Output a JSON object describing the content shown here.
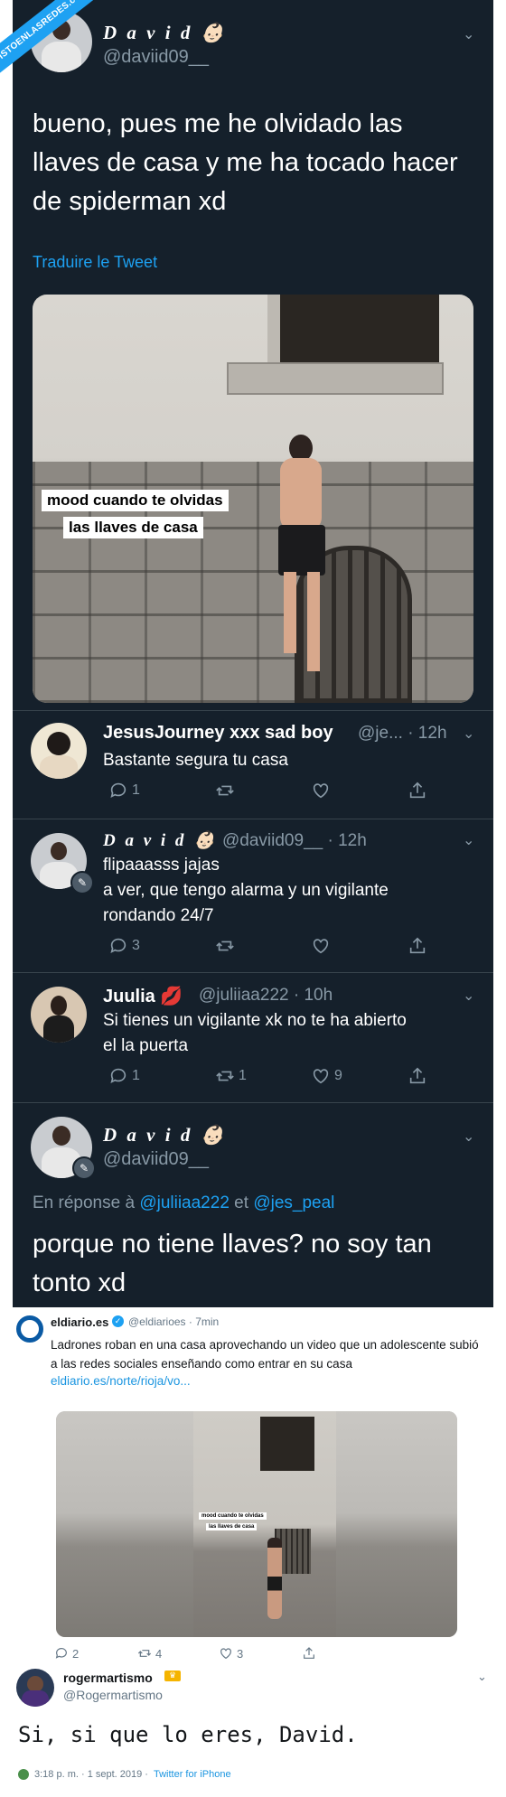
{
  "watermark": "VISTOENLASREDES.com",
  "main_tweet": {
    "name": "D a v i d",
    "name_emoji": "👶🏻",
    "handle": "@daviid09__",
    "text": "bueno, pues me he olvidado las llaves de casa y me ha tocado hacer de spiderman xd",
    "translate_label": "Traduire le Tweet",
    "media_caption_line1": "mood cuando te olvidas",
    "media_caption_line2": "las llaves de casa"
  },
  "replies": [
    {
      "name": "JesusJourney xxx sad boy",
      "handle": "@je...",
      "time": "· 12h",
      "text": "Bastante segura tu casa",
      "reply_count": "1",
      "retweet_count": "",
      "like_count": ""
    },
    {
      "name": "D a v i d",
      "name_emoji": "👶🏻",
      "handle": "@daviid09__",
      "time": "· 12h",
      "text_line1": "flipaaasss jajas",
      "text_line2": "a ver, que tengo alarma y un vigilante",
      "text_line3": "rondando 24/7",
      "reply_count": "3",
      "retweet_count": "",
      "like_count": ""
    },
    {
      "name": "Juulia",
      "name_emoji": "💋",
      "handle": "@juliiaa222",
      "time": "· 10h",
      "text_line1": "Si tienes un vigilante xk no te ha abierto",
      "text_line2": "el la puerta",
      "reply_count": "1",
      "retweet_count": "1",
      "like_count": "9"
    }
  ],
  "final_tweet": {
    "name": "D a v i d",
    "name_emoji": "👶🏻",
    "handle": "@daviid09__",
    "in_reply_prefix": "En réponse à",
    "in_reply_user1": "@juliiaa222",
    "in_reply_and": "et",
    "in_reply_user2": "@jes_peal",
    "text": "porque no tiene llaves? no soy tan tonto xd"
  },
  "eldiario": {
    "name": "eldiario.es",
    "handle_time": "@eldiarioes · 7min",
    "text": "Ladrones roban en una casa aprovechando un video que un adolescente subió a las redes sociales enseñando como entrar en su casa",
    "link": "eldiario.es/norte/rioja/vo...",
    "caption_line1": "mood cuando te olvidas",
    "caption_line2": "las llaves de casa",
    "reply_count": "2",
    "retweet_count": "4",
    "like_count": "3"
  },
  "rogermartismo": {
    "name": "rogermartismo",
    "handle": "@Rogermartismo",
    "text": "Si, si que lo eres, David.",
    "time": "3:18 p. m. · 1 sept. 2019 ·",
    "source": "Twitter for iPhone"
  },
  "colors": {
    "dark_bg": "#15202b",
    "accent": "#1da1f2",
    "muted": "#8899a6"
  }
}
